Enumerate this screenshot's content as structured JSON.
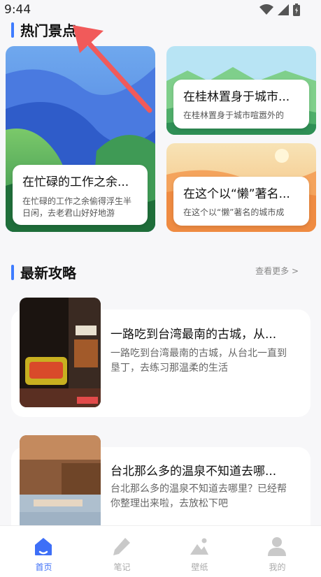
{
  "status_bar": {
    "time": "9:44"
  },
  "hot_spots": {
    "title": "热门景点",
    "cards": [
      {
        "title": "在忙碌的工作之余...",
        "subtitle": "在忙碌的工作之余偷得浮生半日闲，去老君山好好地游"
      },
      {
        "title": "在桂林置身于城市...",
        "subtitle": "在桂林置身于城市喧嚣外的"
      },
      {
        "title": "在这个以“懒”著名...",
        "subtitle": "在这个以“懒”著名的城市成"
      }
    ]
  },
  "latest_guides": {
    "title": "最新攻略",
    "more_label": "查看更多 >",
    "items": [
      {
        "title": "一路吃到台湾最南的古城，从...",
        "subtitle": "一路吃到台湾最南的古城，从台北一直到垦丁，去练习那温柔的生活"
      },
      {
        "title": "台北那么多的温泉不知道去哪...",
        "subtitle": "台北那么多的温泉不知道去哪里？已经帮你整理出来啦，去放松下吧"
      }
    ]
  },
  "bottom_nav": {
    "items": [
      {
        "label": "首页",
        "icon": "home-icon",
        "active": true
      },
      {
        "label": "笔记",
        "icon": "pen-icon",
        "active": false
      },
      {
        "label": "壁纸",
        "icon": "image-icon",
        "active": false
      },
      {
        "label": "我的",
        "icon": "user-icon",
        "active": false
      }
    ]
  },
  "colors": {
    "accent": "#3e7cff",
    "nav_active": "#3e6ff7",
    "annotation": "#f15a5a"
  }
}
